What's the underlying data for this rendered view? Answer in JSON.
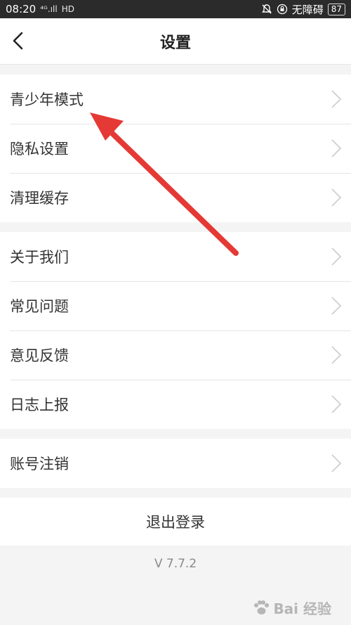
{
  "status_bar": {
    "time": "08:20",
    "signal": "⁴ᴳ.ıll",
    "hd": "HD",
    "network_status": "无障碍",
    "battery": "87"
  },
  "header": {
    "title": "设置"
  },
  "groups": [
    {
      "items": [
        {
          "label": "青少年模式"
        },
        {
          "label": "隐私设置"
        },
        {
          "label": "清理缓存"
        }
      ]
    },
    {
      "items": [
        {
          "label": "关于我们"
        },
        {
          "label": "常见问题"
        },
        {
          "label": "意见反馈"
        },
        {
          "label": "日志上报"
        }
      ]
    },
    {
      "items": [
        {
          "label": "账号注销"
        }
      ]
    }
  ],
  "logout": {
    "label": "退出登录"
  },
  "version": "V 7.7.2",
  "watermark": {
    "text": "Bai 经验"
  },
  "colors": {
    "annotation_arrow": "#e53935",
    "chevron": "#cfcfcf"
  }
}
